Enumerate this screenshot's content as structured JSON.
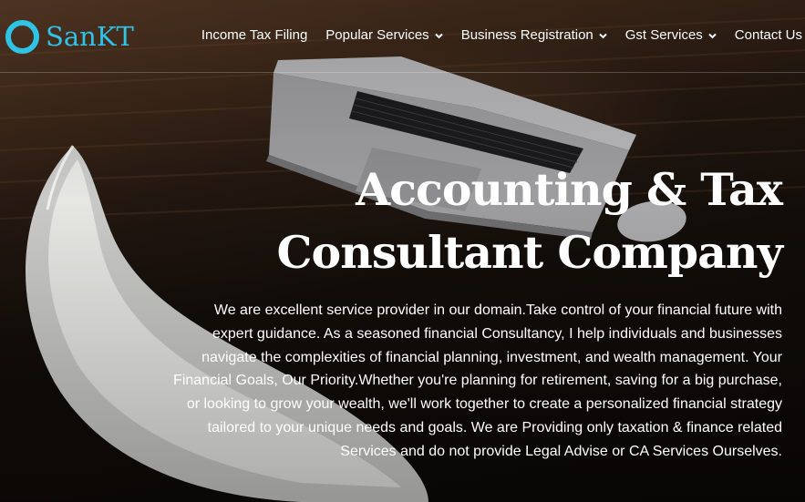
{
  "brand": {
    "name": "SanKT",
    "logo_icon": "ring-logo-icon",
    "accent": "#2ec4e6"
  },
  "nav": {
    "items": [
      {
        "label": "Income Tax Filing",
        "has_dropdown": false
      },
      {
        "label": "Popular Services",
        "has_dropdown": true
      },
      {
        "label": "Business Registration",
        "has_dropdown": true
      },
      {
        "label": "Gst Services",
        "has_dropdown": true
      },
      {
        "label": "Contact Us",
        "has_dropdown": false
      }
    ],
    "dropdown_icon": "chevron-down-icon"
  },
  "hero": {
    "headline_line1": "Accounting & Tax",
    "headline_line2": "Consultant Company",
    "description": "We are excellent service provider in our domain.Take control of your financial future with expert guidance. As a seasoned financial Consultancy, I help individuals and businesses navigate the complexities of financial planning, investment, and wealth management. Your Financial Goals, Our Priority.Whether you're planning for retirement, saving for a big purchase, or looking to grow your wealth, we'll work together to create a personalized financial strategy tailored to your unique needs and goals. We are Providing only taxation & finance related Services and do not provide Legal Advise or CA Services Ourselves.",
    "background": "laptop-on-wooden-desk-with-white-chair-photo"
  }
}
